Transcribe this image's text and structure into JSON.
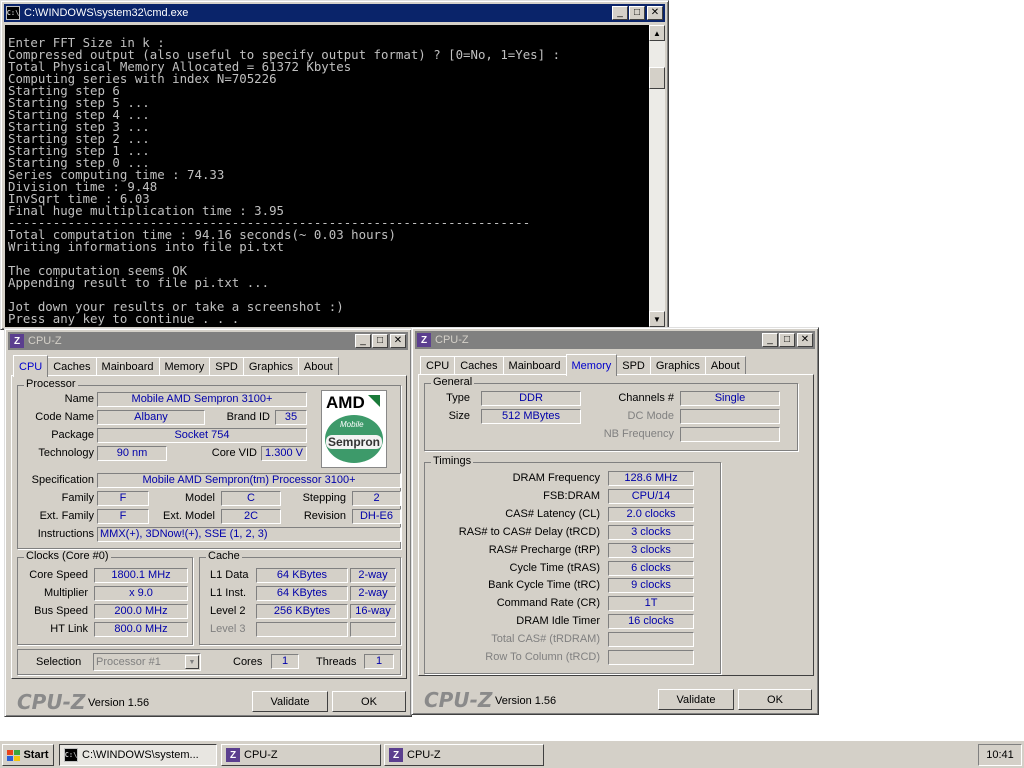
{
  "cmd": {
    "title": "C:\\WINDOWS\\system32\\cmd.exe",
    "icon": "C:\\",
    "lines": [
      "",
      "Enter FFT Size in k :",
      "Compressed output (also useful to specify output format) ? [0=No, 1=Yes] :",
      "Total Physical Memory Allocated = 61372 Kbytes",
      "Computing series with index N=705226",
      "Starting step 6",
      "Starting step 5 ...",
      "Starting step 4 ...",
      "Starting step 3 ...",
      "Starting step 2 ...",
      "Starting step 1 ...",
      "Starting step 0 ...",
      "Series computing time : 74.33",
      "Division time : 9.48",
      "InvSqrt time : 6.03",
      "Final huge multiplication time : 3.95",
      "----------------------------------------------------------------------",
      "Total computation time : 94.16 seconds(~ 0.03 hours)",
      "Writing informations into file pi.txt",
      "",
      "The computation seems OK",
      "Appending result to file pi.txt ...",
      "",
      "Jot down your results or take a screenshot :)",
      "Press any key to continue . . ."
    ]
  },
  "cpuz1": {
    "title": "CPU-Z",
    "tabs": [
      "CPU",
      "Caches",
      "Mainboard",
      "Memory",
      "SPD",
      "Graphics",
      "About"
    ],
    "selected_tab": "CPU",
    "processor_group": "Processor",
    "name_label": "Name",
    "name": "Mobile AMD Sempron 3100+",
    "codename_label": "Code Name",
    "codename": "Albany",
    "brandid_label": "Brand ID",
    "brandid": "35",
    "package_label": "Package",
    "package": "Socket 754",
    "technology_label": "Technology",
    "technology": "90 nm",
    "corevid_label": "Core VID",
    "corevid": "1.300 V",
    "spec_label": "Specification",
    "spec": "Mobile AMD Sempron(tm) Processor 3100+",
    "family_label": "Family",
    "family": "F",
    "model_label": "Model",
    "model": "C",
    "stepping_label": "Stepping",
    "stepping": "2",
    "extfamily_label": "Ext. Family",
    "extfamily": "F",
    "extmodel_label": "Ext. Model",
    "extmodel": "2C",
    "revision_label": "Revision",
    "revision": "DH-E6",
    "instructions_label": "Instructions",
    "instructions": "MMX(+), 3DNow!(+), SSE (1, 2, 3)",
    "logo_amd": "AMD",
    "logo_mobile": "Mobile",
    "logo_sempron": "Sempron",
    "clocks_group": "Clocks (Core #0)",
    "corespeed_label": "Core Speed",
    "corespeed": "1800.1 MHz",
    "multiplier_label": "Multiplier",
    "multiplier": "x 9.0",
    "busspeed_label": "Bus Speed",
    "busspeed": "200.0 MHz",
    "htlink_label": "HT Link",
    "htlink": "800.0 MHz",
    "cache_group": "Cache",
    "l1data_label": "L1 Data",
    "l1data": "64 KBytes",
    "l1data_way": "2-way",
    "l1inst_label": "L1 Inst.",
    "l1inst": "64 KBytes",
    "l1inst_way": "2-way",
    "level2_label": "Level 2",
    "level2": "256 KBytes",
    "level2_way": "16-way",
    "level3_label": "Level 3",
    "selection_label": "Selection",
    "selection": "Processor #1",
    "cores_label": "Cores",
    "cores": "1",
    "threads_label": "Threads",
    "threads": "1",
    "brand": "CPU-Z",
    "version": "Version 1.56",
    "validate": "Validate",
    "ok": "OK"
  },
  "cpuz2": {
    "title": "CPU-Z",
    "tabs": [
      "CPU",
      "Caches",
      "Mainboard",
      "Memory",
      "SPD",
      "Graphics",
      "About"
    ],
    "selected_tab": "Memory",
    "general_group": "General",
    "type_label": "Type",
    "type": "DDR",
    "size_label": "Size",
    "size": "512 MBytes",
    "channels_label": "Channels #",
    "channels": "Single",
    "dcmode_label": "DC Mode",
    "nbfreq_label": "NB Frequency",
    "timings_group": "Timings",
    "timings": [
      {
        "label": "DRAM Frequency",
        "value": "128.6 MHz",
        "enabled": true
      },
      {
        "label": "FSB:DRAM",
        "value": "CPU/14",
        "enabled": true
      },
      {
        "label": "CAS# Latency (CL)",
        "value": "2.0 clocks",
        "enabled": true
      },
      {
        "label": "RAS# to CAS# Delay (tRCD)",
        "value": "3 clocks",
        "enabled": true
      },
      {
        "label": "RAS# Precharge (tRP)",
        "value": "3 clocks",
        "enabled": true
      },
      {
        "label": "Cycle Time (tRAS)",
        "value": "6 clocks",
        "enabled": true
      },
      {
        "label": "Bank Cycle Time (tRC)",
        "value": "9 clocks",
        "enabled": true
      },
      {
        "label": "Command Rate (CR)",
        "value": "1T",
        "enabled": true
      },
      {
        "label": "DRAM Idle Timer",
        "value": "16 clocks",
        "enabled": true
      },
      {
        "label": "Total CAS# (tRDRAM)",
        "value": "",
        "enabled": false
      },
      {
        "label": "Row To Column (tRCD)",
        "value": "",
        "enabled": false
      }
    ],
    "brand": "CPU-Z",
    "version": "Version 1.56",
    "validate": "Validate",
    "ok": "OK"
  },
  "taskbar": {
    "start": "Start",
    "tasks": [
      {
        "icon": "cmd-icon",
        "label": "C:\\WINDOWS\\system..."
      },
      {
        "icon": "cpuz-icon",
        "label": "CPU-Z"
      },
      {
        "icon": "cpuz-icon",
        "label": "CPU-Z"
      }
    ],
    "clock": "10:41"
  },
  "colors": {
    "titlebar_active": "#0a246a",
    "titlebar_inactive": "#808080",
    "face": "#d4d0c8",
    "value_text": "#0000aa",
    "selected_tab_text": "#0000cc"
  },
  "icons": {
    "minimize": "minimize-icon",
    "maximize": "maximize-icon",
    "close": "close-icon",
    "scroll_up": "arrow-up-icon",
    "scroll_down": "arrow-down-icon",
    "windows_logo": "windows-logo-icon",
    "dropdown": "chevron-down-icon"
  }
}
